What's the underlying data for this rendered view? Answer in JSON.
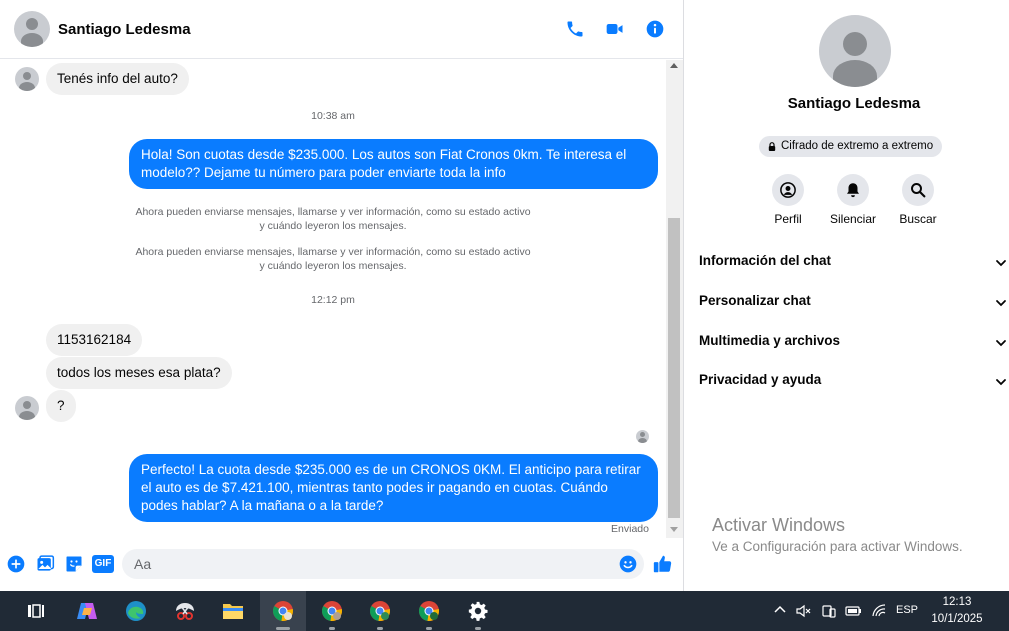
{
  "contact": {
    "name": "Santiago Ledesma"
  },
  "header_icons": [
    "phone-icon",
    "video-camera-icon",
    "info-icon"
  ],
  "messages": {
    "m1": "Tenés info del auto?",
    "t1": "10:38 am",
    "m2": "Hola! Son cuotas desde $235.000. Los autos son Fiat Cronos 0km. Te interesa el modelo?? Dejame tu número para poder enviarte toda la info",
    "notice1_line1": "Ahora pueden enviarse mensajes, llamarse y ver información, como su estado activo",
    "notice1_line2": "y cuándo leyeron los mensajes.",
    "notice2_line1": "Ahora pueden enviarse mensajes, llamarse y ver información, como su estado activo",
    "notice2_line2": "y cuándo leyeron los mensajes.",
    "t2": "12:12 pm",
    "m3": "1153162184",
    "m4": "todos los meses esa plata?",
    "m5": "?",
    "m6": "Perfecto! La cuota desde $235.000 es de un CRONOS 0KM. El anticipo para retirar el auto es de $7.421.100, mientras tanto podes ir pagando en cuotas. Cuándo podes hablar? A la mañana o a la tarde?",
    "status": "Enviado"
  },
  "composer": {
    "placeholder": "Aa",
    "value": "",
    "icons": [
      "plus-icon",
      "image-icon",
      "sticker-icon",
      "gif-icon",
      "emoji-icon",
      "thumbs-up-icon"
    ],
    "gif_label": "GIF"
  },
  "info_panel": {
    "name": "Santiago Ledesma",
    "badge": "Cifrado de extremo a extremo",
    "actions": {
      "profile": "Perfil",
      "mute": "Silenciar",
      "search": "Buscar"
    },
    "sections": {
      "chat_info": "Información del chat",
      "customize": "Personalizar chat",
      "media": "Multimedia y archivos",
      "privacy": "Privacidad y ayuda"
    }
  },
  "watermark": {
    "title": "Activar Windows",
    "subtitle": "Ve a Configuración para activar Windows."
  },
  "taskbar": {
    "apps": [
      "windows-start-icon",
      "task-view-icon",
      "copilot-icon",
      "edge-icon",
      "snipping-tool-icon",
      "file-explorer-icon",
      "chrome-icon",
      "chrome-profile-icon",
      "chrome-profile-v-icon",
      "chrome-profile-t-icon",
      "settings-icon"
    ],
    "language": "ESP",
    "time": "12:13",
    "date": "10/1/2025"
  },
  "colors": {
    "accent": "#0a7cff",
    "incoming_bubble": "#f0f0f0",
    "taskbar": "#202a36"
  }
}
